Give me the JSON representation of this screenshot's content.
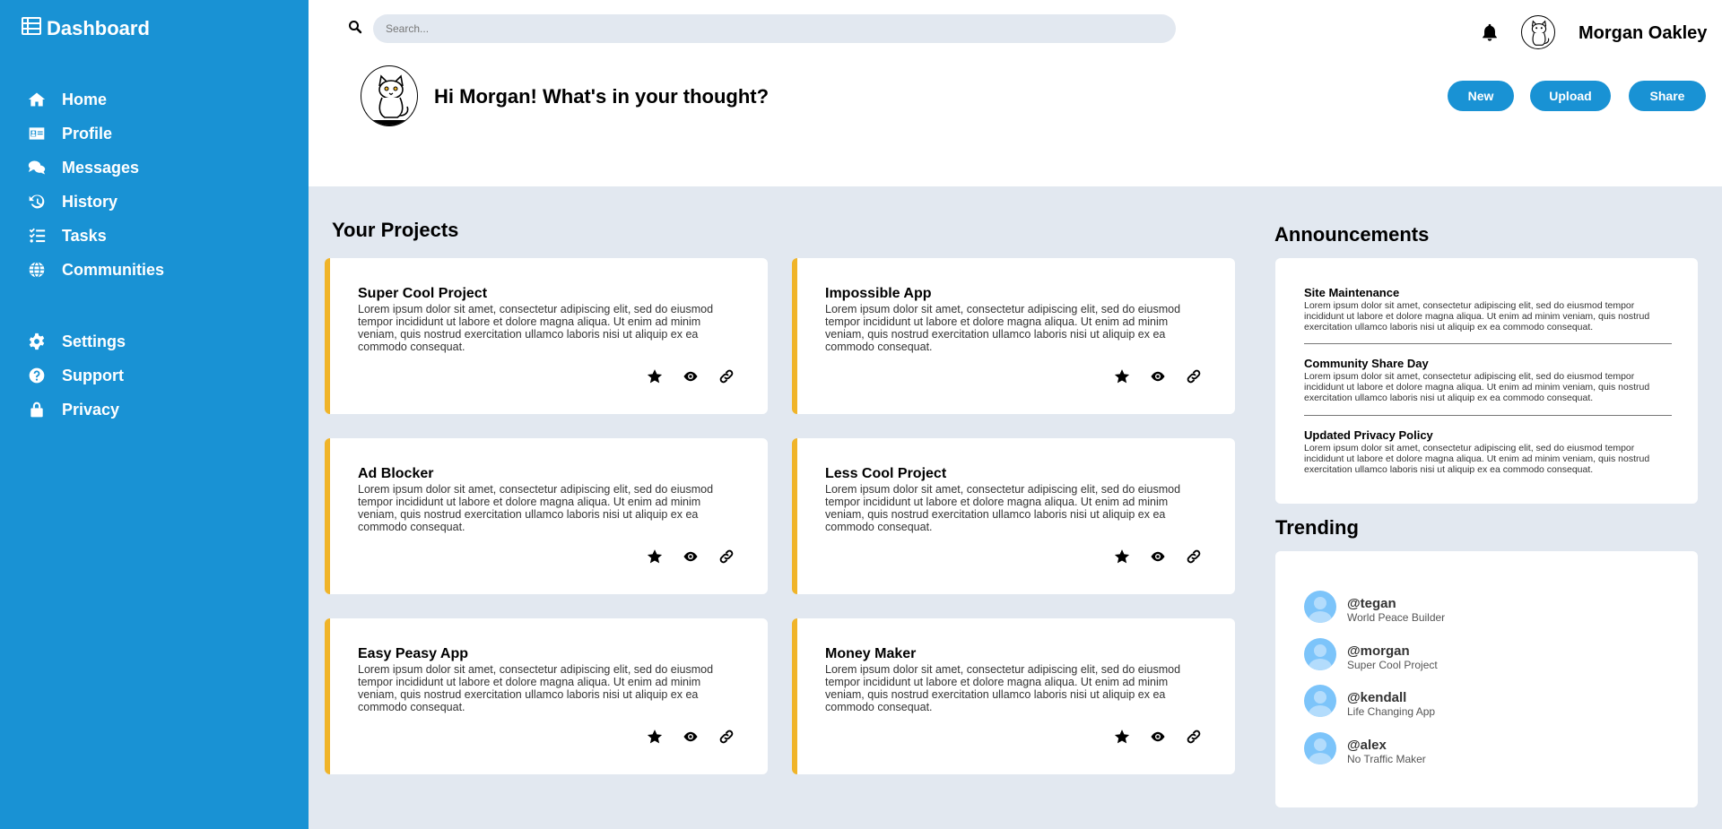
{
  "sidebar": {
    "brand": "Dashboard",
    "nav_main": [
      {
        "label": "Home",
        "icon": "home-icon"
      },
      {
        "label": "Profile",
        "icon": "id-card-icon"
      },
      {
        "label": "Messages",
        "icon": "chat-icon"
      },
      {
        "label": "History",
        "icon": "history-icon"
      },
      {
        "label": "Tasks",
        "icon": "tasks-icon"
      },
      {
        "label": "Communities",
        "icon": "globe-icon"
      }
    ],
    "nav_secondary": [
      {
        "label": "Settings",
        "icon": "gear-icon"
      },
      {
        "label": "Support",
        "icon": "help-icon"
      },
      {
        "label": "Privacy",
        "icon": "lock-icon"
      }
    ]
  },
  "header": {
    "search_placeholder": "Search...",
    "username": "Morgan Oakley",
    "greeting": "Hi Morgan! What's in your thought?",
    "buttons": {
      "new": "New",
      "upload": "Upload",
      "share": "Share"
    }
  },
  "projects": {
    "title": "Your Projects",
    "items": [
      {
        "title": "Super Cool Project",
        "desc": "Lorem ipsum dolor sit amet, consectetur adipiscing elit, sed do eiusmod tempor incididunt ut labore et dolore magna aliqua. Ut enim ad minim veniam, quis nostrud exercitation ullamco laboris nisi ut aliquip ex ea commodo consequat."
      },
      {
        "title": "Impossible App",
        "desc": "Lorem ipsum dolor sit amet, consectetur adipiscing elit, sed do eiusmod tempor incididunt ut labore et dolore magna aliqua. Ut enim ad minim veniam, quis nostrud exercitation ullamco laboris nisi ut aliquip ex ea commodo consequat."
      },
      {
        "title": "Ad Blocker",
        "desc": "Lorem ipsum dolor sit amet, consectetur adipiscing elit, sed do eiusmod tempor incididunt ut labore et dolore magna aliqua. Ut enim ad minim veniam, quis nostrud exercitation ullamco laboris nisi ut aliquip ex ea commodo consequat."
      },
      {
        "title": "Less Cool Project",
        "desc": "Lorem ipsum dolor sit amet, consectetur adipiscing elit, sed do eiusmod tempor incididunt ut labore et dolore magna aliqua. Ut enim ad minim veniam, quis nostrud exercitation ullamco laboris nisi ut aliquip ex ea commodo consequat."
      },
      {
        "title": "Easy Peasy App",
        "desc": "Lorem ipsum dolor sit amet, consectetur adipiscing elit, sed do eiusmod tempor incididunt ut labore et dolore magna aliqua. Ut enim ad minim veniam, quis nostrud exercitation ullamco laboris nisi ut aliquip ex ea commodo consequat."
      },
      {
        "title": "Money Maker",
        "desc": "Lorem ipsum dolor sit amet, consectetur adipiscing elit, sed do eiusmod tempor incididunt ut labore et dolore magna aliqua. Ut enim ad minim veniam, quis nostrud exercitation ullamco laboris nisi ut aliquip ex ea commodo consequat."
      }
    ]
  },
  "announcements": {
    "title": "Announcements",
    "items": [
      {
        "title": "Site Maintenance",
        "desc": "Lorem ipsum dolor sit amet, consectetur adipiscing elit, sed do eiusmod tempor incididunt ut labore et dolore magna aliqua. Ut enim ad minim veniam, quis nostrud exercitation ullamco laboris nisi ut aliquip ex ea commodo consequat."
      },
      {
        "title": "Community Share Day",
        "desc": "Lorem ipsum dolor sit amet, consectetur adipiscing elit, sed do eiusmod tempor incididunt ut labore et dolore magna aliqua. Ut enim ad minim veniam, quis nostrud exercitation ullamco laboris nisi ut aliquip ex ea commodo consequat."
      },
      {
        "title": "Updated Privacy Policy",
        "desc": "Lorem ipsum dolor sit amet, consectetur adipiscing elit, sed do eiusmod tempor incididunt ut labore et dolore magna aliqua. Ut enim ad minim veniam, quis nostrud exercitation ullamco laboris nisi ut aliquip ex ea commodo consequat."
      }
    ]
  },
  "trending": {
    "title": "Trending",
    "items": [
      {
        "handle": "@tegan",
        "project": "World Peace Builder"
      },
      {
        "handle": "@morgan",
        "project": "Super Cool Project"
      },
      {
        "handle": "@kendall",
        "project": "Life Changing App"
      },
      {
        "handle": "@alex",
        "project": "No Traffic Maker"
      }
    ]
  },
  "colors": {
    "primary": "#1992d4",
    "accent": "#f0b429",
    "background": "#e2e8f0"
  }
}
